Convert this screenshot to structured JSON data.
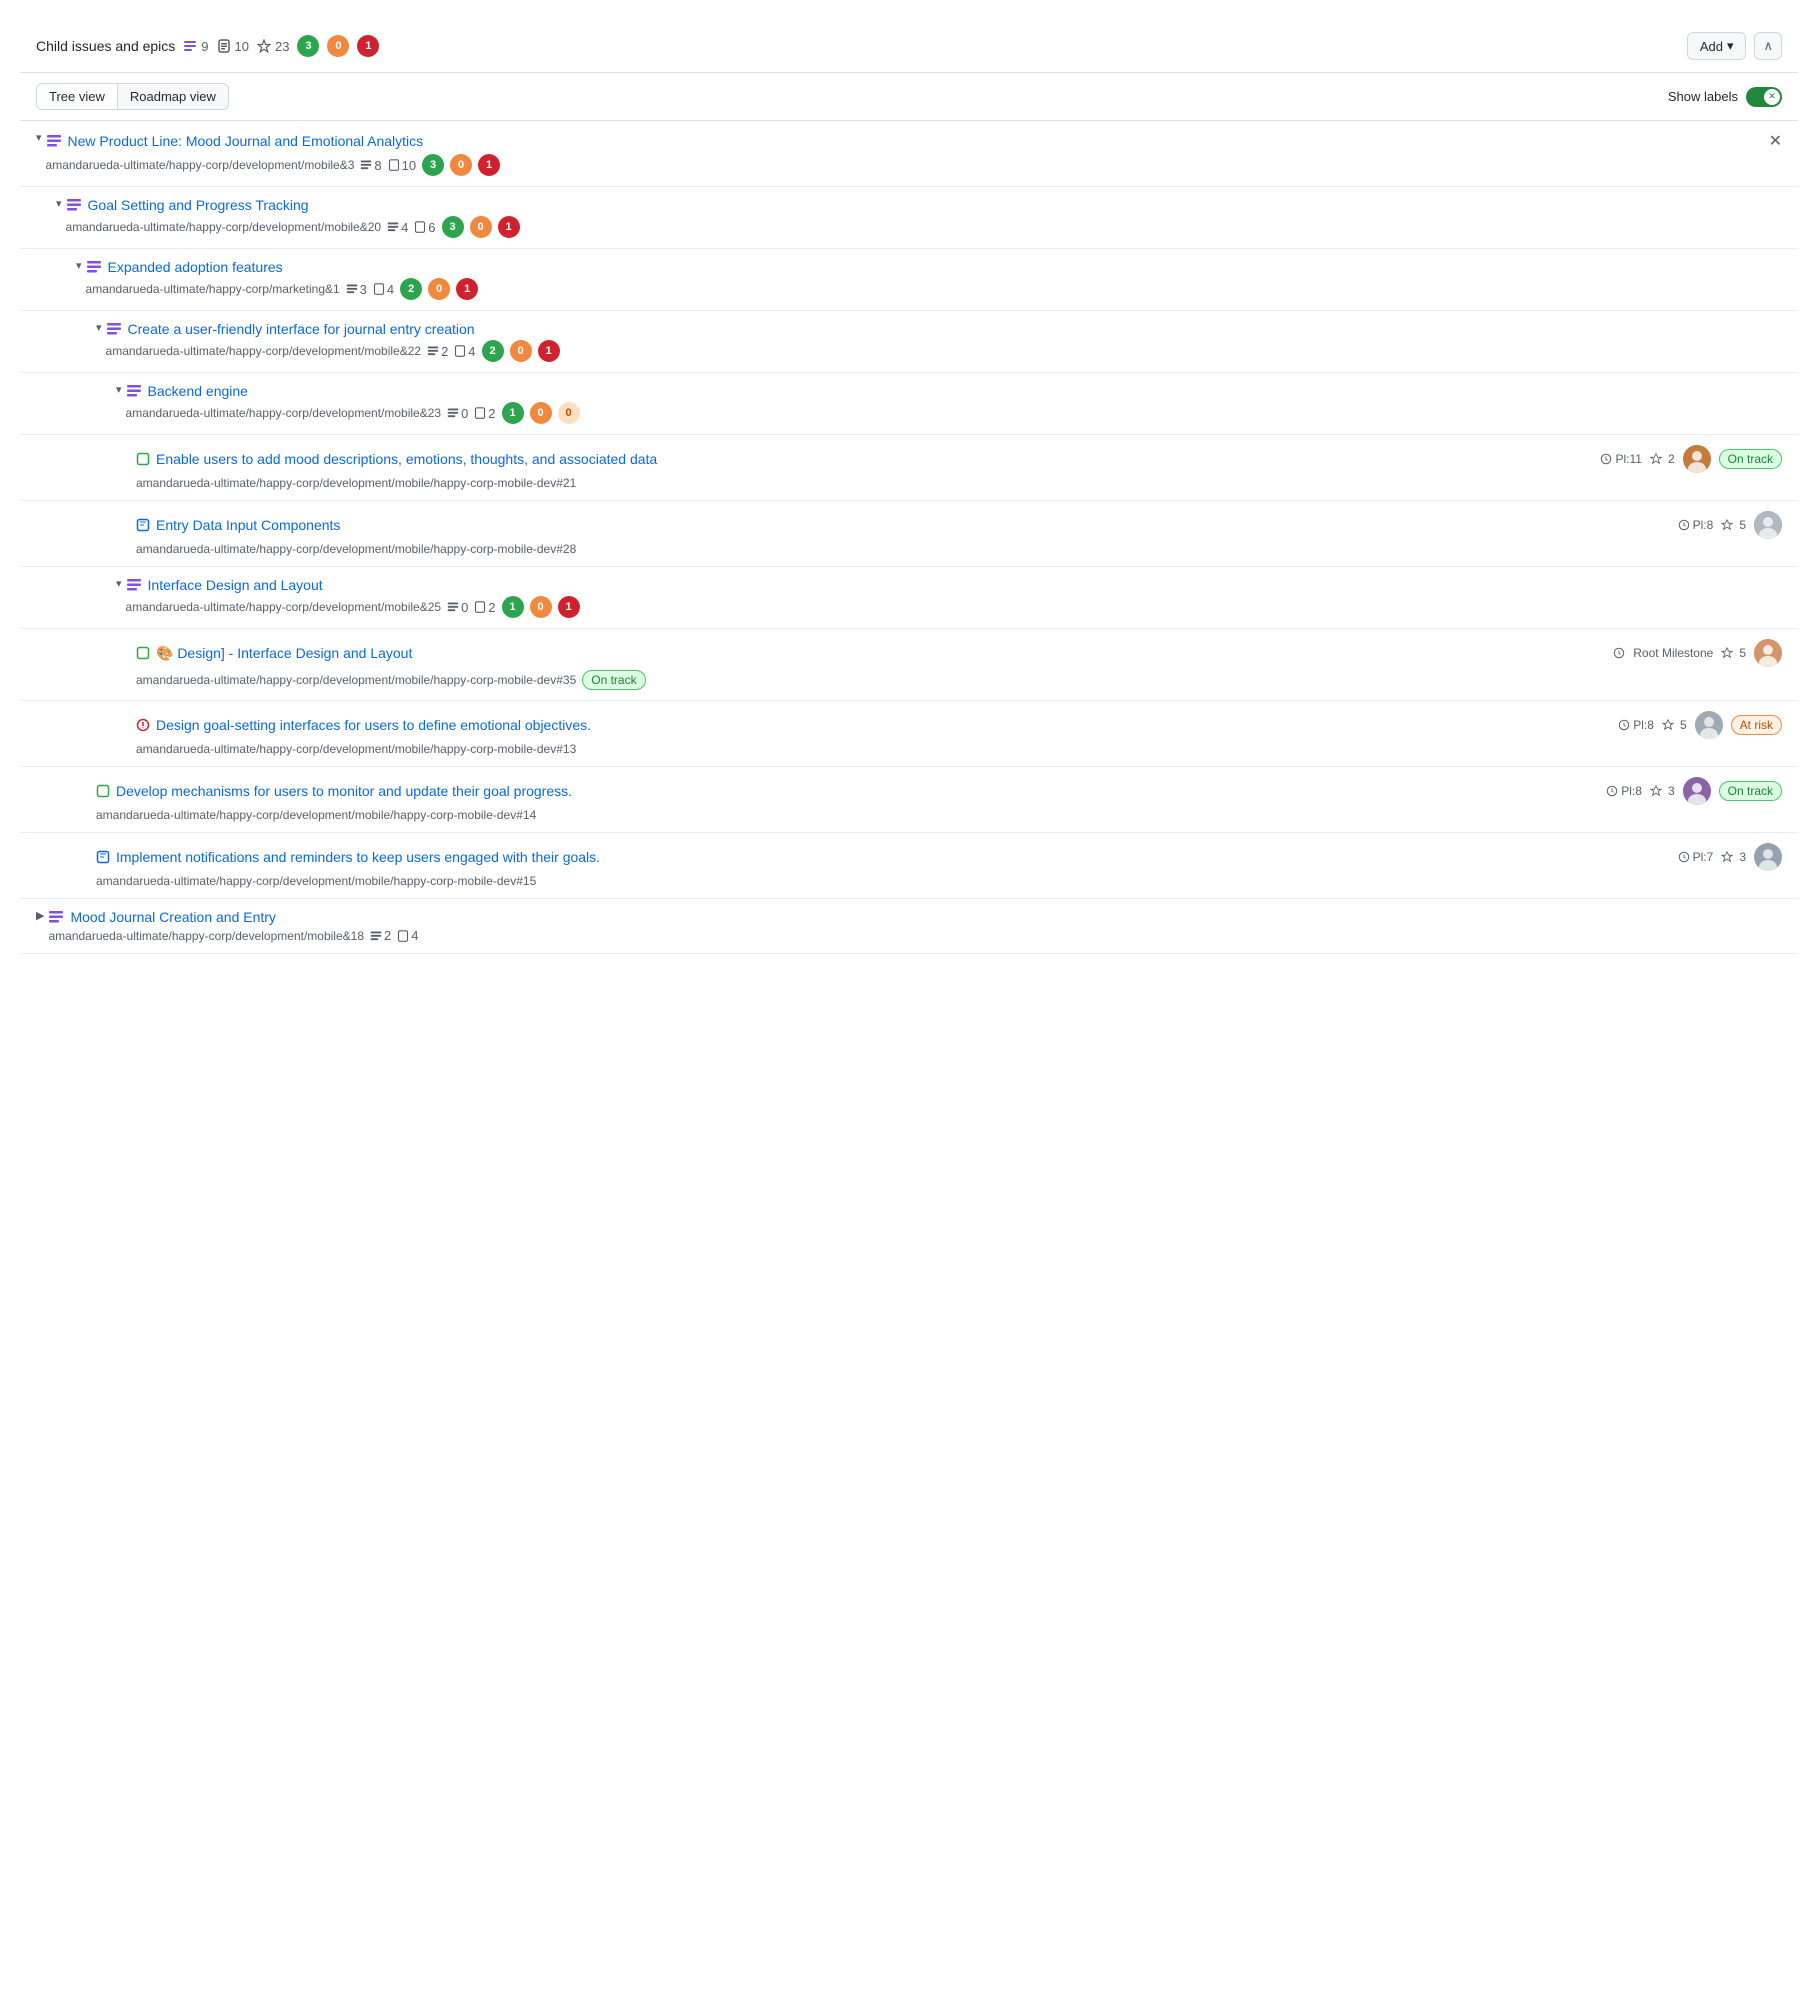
{
  "header": {
    "title": "Child issues and epics",
    "epics_count": 9,
    "issues_count": 10,
    "milestones_count": 23,
    "badges": [
      {
        "value": 3,
        "color": "green"
      },
      {
        "value": 0,
        "color": "orange"
      },
      {
        "value": 1,
        "color": "red"
      }
    ],
    "add_label": "Add",
    "collapse_icon": "∧"
  },
  "toolbar": {
    "tree_view_label": "Tree view",
    "roadmap_view_label": "Roadmap view",
    "show_labels_label": "Show labels"
  },
  "items": [
    {
      "id": "row-1",
      "level": 0,
      "expanded": true,
      "type": "epic",
      "title": "New Product Line: Mood Journal and Emotional Analytics",
      "path": "amandarueda-ultimate/happy-corp/development/mobile&3",
      "epics": 8,
      "issues": 10,
      "badges": [
        3,
        0,
        1
      ],
      "has_close": true
    },
    {
      "id": "row-2",
      "level": 1,
      "expanded": true,
      "type": "epic",
      "title": "Goal Setting and Progress Tracking",
      "path": "amandarueda-ultimate/happy-corp/development/mobile&20",
      "epics": 4,
      "issues": 6,
      "badges": [
        3,
        0,
        1
      ]
    },
    {
      "id": "row-3",
      "level": 2,
      "expanded": true,
      "type": "epic",
      "title": "Expanded adoption features",
      "path": "amandarueda-ultimate/happy-corp/marketing&1",
      "epics": 3,
      "issues": 4,
      "badges": [
        2,
        0,
        1
      ]
    },
    {
      "id": "row-4",
      "level": 3,
      "expanded": true,
      "type": "epic",
      "title": "Create a user-friendly interface for journal entry creation",
      "path": "amandarueda-ultimate/happy-corp/development/mobile&22",
      "epics": 2,
      "issues": 4,
      "badges": [
        2,
        0,
        1
      ]
    },
    {
      "id": "row-5",
      "level": 4,
      "expanded": true,
      "type": "epic",
      "title": "Backend engine",
      "path": "amandarueda-ultimate/happy-corp/development/mobile&23",
      "epics": 0,
      "issues": 2,
      "badges": [
        1,
        0,
        0
      ]
    },
    {
      "id": "row-6",
      "level": 5,
      "type": "issue-green",
      "title": "Enable users to add mood descriptions, emotions, thoughts, and associated data",
      "path": "amandarueda-ultimate/happy-corp/development/mobile/happy-corp-mobile-dev#21",
      "pi": "11",
      "weight": "2",
      "has_avatar": true,
      "avatar_type": "photo-brown",
      "status": "on-track"
    },
    {
      "id": "row-7",
      "level": 5,
      "type": "issue-blue",
      "title": "Entry Data Input Components",
      "path": "amandarueda-ultimate/happy-corp/development/mobile/happy-corp-mobile-dev#28",
      "pi": "8",
      "weight": "5",
      "has_avatar": true,
      "avatar_type": "photo-gray"
    },
    {
      "id": "row-8",
      "level": 4,
      "expanded": true,
      "type": "epic",
      "title": "Interface Design and Layout",
      "path": "amandarueda-ultimate/happy-corp/development/mobile&25",
      "epics": 0,
      "issues": 2,
      "badges": [
        1,
        0,
        1
      ]
    },
    {
      "id": "row-9",
      "level": 5,
      "type": "issue-green",
      "title": "[🎨 Design] - Interface Design and Layout",
      "path": "amandarueda-ultimate/happy-corp/development/mobile/happy-corp-mobile-dev#35",
      "milestone": "Root Milestone",
      "weight": "5",
      "has_avatar": true,
      "avatar_type": "photo-woman",
      "status": "on-track",
      "status_below": true
    },
    {
      "id": "row-10",
      "level": 5,
      "type": "issue-red",
      "title": "Design goal-setting interfaces for users to define emotional objectives.",
      "path": "amandarueda-ultimate/happy-corp/development/mobile/happy-corp-mobile-dev#13",
      "pi": "8",
      "weight": "5",
      "has_avatar": true,
      "avatar_type": "photo-gray2",
      "status": "at-risk"
    },
    {
      "id": "row-11",
      "level": 3,
      "type": "issue-green",
      "title": "Develop mechanisms for users to monitor and update their goal progress.",
      "path": "amandarueda-ultimate/happy-corp/development/mobile/happy-corp-mobile-dev#14",
      "pi": "8",
      "weight": "3",
      "has_avatar": true,
      "avatar_type": "photo-woman2",
      "status": "on-track"
    },
    {
      "id": "row-12",
      "level": 3,
      "type": "issue-blue",
      "title": "Implement notifications and reminders to keep users engaged with their goals.",
      "path": "amandarueda-ultimate/happy-corp/development/mobile/happy-corp-mobile-dev#15",
      "pi": "7",
      "weight": "3",
      "has_avatar": true,
      "avatar_type": "photo-gray3"
    },
    {
      "id": "row-13",
      "level": 0,
      "expanded": false,
      "type": "epic",
      "title": "Mood Journal Creation and Entry",
      "path": "amandarueda-ultimate/happy-corp/development/mobile&18",
      "epics": 2,
      "issues": 4,
      "badges": []
    }
  ]
}
